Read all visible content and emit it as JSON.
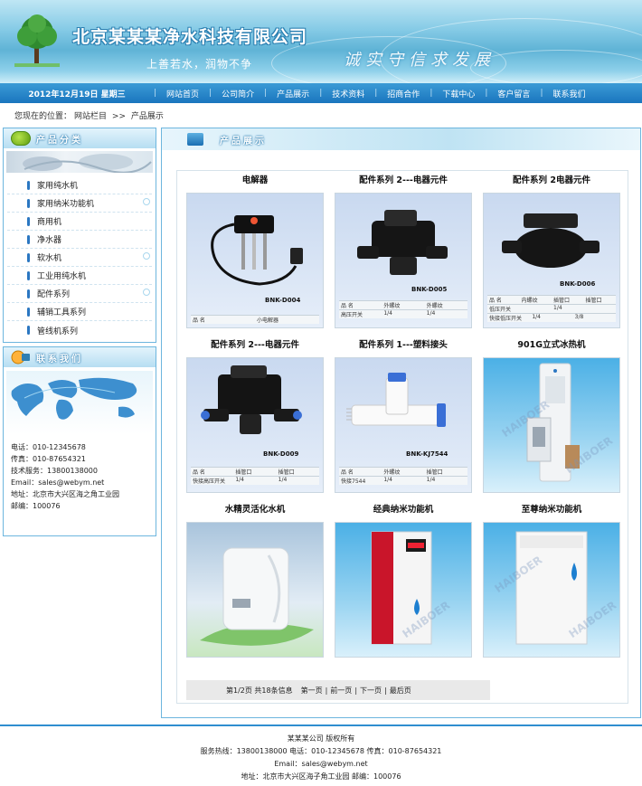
{
  "header": {
    "company_name": "北京某某某净水科技有限公司",
    "slogan": "上善若水，润物不争",
    "motto": "诚实守信求发展"
  },
  "nav": {
    "date": "2012年12月19日  星期三",
    "items": [
      "网站首页",
      "公司简介",
      "产品展示",
      "技术资料",
      "招商合作",
      "下载中心",
      "客户留言",
      "联系我们"
    ]
  },
  "breadcrumb": {
    "prefix": "您现在的位置：",
    "root": "网站栏目",
    "sep": ">>",
    "current": "产品展示"
  },
  "sidebar": {
    "categories_title": "产品分类",
    "categories": [
      "家用纯水机",
      "家用纳米功能机",
      "商用机",
      "净水器",
      "软水机",
      "工业用纯水机",
      "配件系列",
      "辅销工具系列",
      "管线机系列"
    ],
    "contact_title": "联系我们",
    "contact": {
      "phone": "电话：010-12345678",
      "fax": "传真：010-87654321",
      "service": "技术服务：13800138000",
      "email": "Email：sales@webym.net",
      "address": "地址：北京市大兴区海之角工业园",
      "postcode": "邮编：100076"
    }
  },
  "main": {
    "title": "产品展示",
    "products": [
      {
        "name": "电解器",
        "model": "BNK-D004",
        "table": [
          "品  名",
          "小电解器"
        ]
      },
      {
        "name": "配件系列 2---电器元件",
        "model": "BNK-D005",
        "table": [
          "品  名",
          "外螺纹",
          "外螺纹",
          "高压开关",
          "1/4",
          "1/4"
        ]
      },
      {
        "name": "配件系列 2电器元件",
        "model": "BNK-D006",
        "table": [
          "品  名",
          "内螺纹",
          "插管口",
          "插管口",
          "低压开关",
          "1/4",
          "快接低压开关",
          "1/4",
          "3/8"
        ]
      },
      {
        "name": "配件系列 2---电器元件",
        "model": "BNK-D009",
        "table": [
          "品  名",
          "插管口",
          "插管口",
          "快接高压开关",
          "1/4",
          "1/4"
        ]
      },
      {
        "name": "配件系列 1---塑料接头",
        "model": "BNK-KJ7544",
        "table": [
          "品  名",
          "外螺纹",
          "插管口",
          "快接7544",
          "1/4",
          "1/4"
        ]
      },
      {
        "name": "901G立式冰热机",
        "model": "",
        "table": []
      },
      {
        "name": "水精灵活化水机",
        "model": "",
        "table": []
      },
      {
        "name": "经典纳米功能机",
        "model": "",
        "table": []
      },
      {
        "name": "至尊纳米功能机",
        "model": "",
        "table": []
      }
    ],
    "watermark": "HAIBOER"
  },
  "pager": {
    "info": "第1/2页   共18条信息",
    "first": "第一页",
    "prev": "前一页",
    "next": "下一页",
    "last": "最后页",
    "sep": "|"
  },
  "footer": {
    "copyright": "某某某公司 版权所有",
    "contact_line": "服务热线：13800138000   电话：010-12345678   传真：010-87654321",
    "email_line": "Email：sales@webym.net",
    "address_line": "地址：北京市大兴区海子角工业园   邮编：100076"
  },
  "colors": {
    "nav_bg": "#1a75be",
    "panel_border": "#6db6de",
    "accent": "#2b77c2"
  }
}
